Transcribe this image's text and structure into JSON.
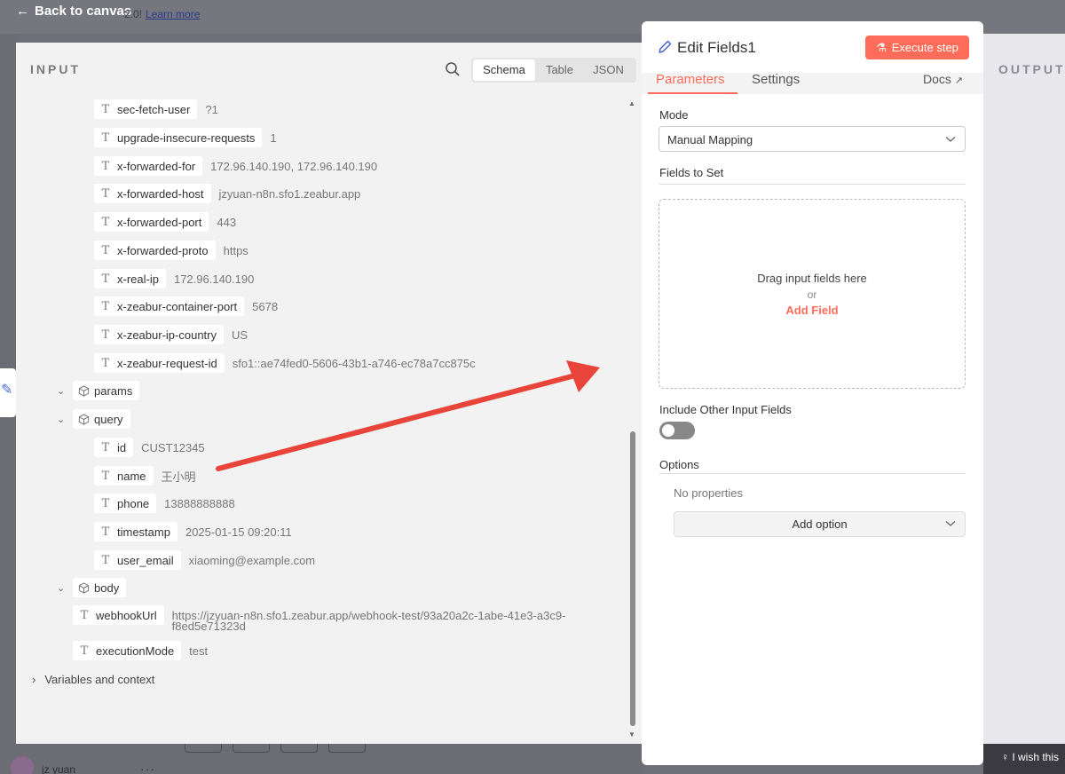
{
  "topbar": {
    "back_label": "Back to canvas",
    "behind_text": "2.0!",
    "learn_more": "Learn more"
  },
  "user": {
    "name": "jz yuan",
    "more": "···"
  },
  "output": {
    "label": "OUTPUT"
  },
  "feedback": {
    "label": "I wish this"
  },
  "input": {
    "title": "INPUT",
    "tabs": [
      "Schema",
      "Table",
      "JSON"
    ],
    "active_tab": "Schema",
    "headers": [
      {
        "key": "sec-fetch-user",
        "value": "?1"
      },
      {
        "key": "upgrade-insecure-requests",
        "value": "1"
      },
      {
        "key": "x-forwarded-for",
        "value": "172.96.140.190, 172.96.140.190"
      },
      {
        "key": "x-forwarded-host",
        "value": "jzyuan-n8n.sfo1.zeabur.app"
      },
      {
        "key": "x-forwarded-port",
        "value": "443"
      },
      {
        "key": "x-forwarded-proto",
        "value": "https"
      },
      {
        "key": "x-real-ip",
        "value": "172.96.140.190"
      },
      {
        "key": "x-zeabur-container-port",
        "value": "5678"
      },
      {
        "key": "x-zeabur-ip-country",
        "value": "US"
      },
      {
        "key": "x-zeabur-request-id",
        "value": "sfo1::ae74fed0-5606-43b1-a746-ec78a7cc875c"
      }
    ],
    "params_label": "params",
    "query_label": "query",
    "query": [
      {
        "key": "id",
        "value": "CUST12345"
      },
      {
        "key": "name",
        "value": "王小明"
      },
      {
        "key": "phone",
        "value": "13888888888"
      },
      {
        "key": "timestamp",
        "value": "2025-01-15 09:20:11"
      },
      {
        "key": "user_email",
        "value": "xiaoming@example.com"
      }
    ],
    "body_label": "body",
    "body": [
      {
        "key": "webhookUrl",
        "value_line1": "https://jzyuan-n8n.sfo1.zeabur.app/webhook-test/93a20a2c-1abe-41e3-a3c9-",
        "value_line2": "f8ed5e71323d"
      },
      {
        "key": "executionMode",
        "value": "test"
      }
    ],
    "variables_label": "Variables and context"
  },
  "edit": {
    "title": "Edit Fields1",
    "execute_label": "Execute step",
    "tabs": {
      "parameters": "Parameters",
      "settings": "Settings",
      "docs": "Docs"
    },
    "mode_label": "Mode",
    "mode_value": "Manual Mapping",
    "fields_to_set_label": "Fields to Set",
    "drop_main": "Drag input fields here",
    "drop_or": "or",
    "add_field": "Add Field",
    "include_label": "Include Other Input Fields",
    "options_label": "Options",
    "no_properties": "No properties",
    "add_option": "Add option"
  },
  "colors": {
    "accent": "#ff6d5a",
    "panel_bg": "#f2f2f2",
    "overlay": "#6e6e78"
  }
}
